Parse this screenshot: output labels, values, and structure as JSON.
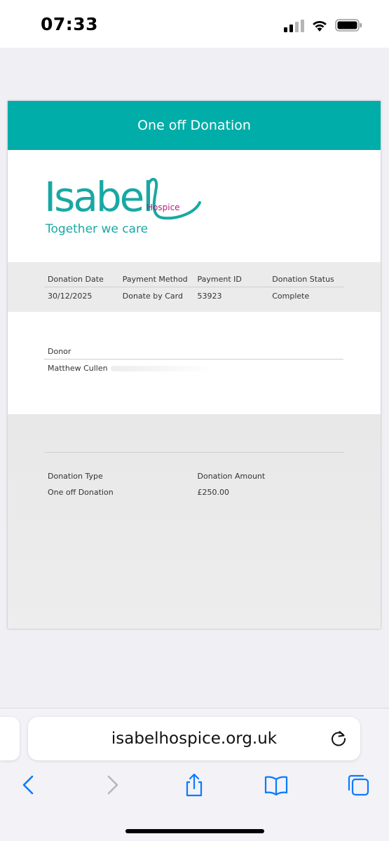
{
  "status_bar": {
    "time": "07:33"
  },
  "page": {
    "header_title": "One off Donation",
    "logo": {
      "name": "Isabel",
      "sub": "Hospice",
      "tagline": "Together we care"
    },
    "summary": {
      "headers": [
        "Donation Date",
        "Payment Method",
        "Payment ID",
        "Donation Status"
      ],
      "values": [
        "30/12/2025",
        "Donate by Card",
        "53923",
        "Complete"
      ]
    },
    "donor": {
      "header": "Donor",
      "value": "Matthew Cullen"
    },
    "details": {
      "headers": [
        "Donation Type",
        "Donation Amount"
      ],
      "values": [
        "One off Donation",
        "£250.00"
      ]
    }
  },
  "browser": {
    "url": "isabelhospice.org.uk",
    "icons": [
      "reload-icon",
      "back-icon",
      "forward-icon",
      "share-icon",
      "bookmarks-icon",
      "tabs-icon"
    ],
    "accent": "#0a7aff"
  },
  "colors": {
    "teal": "#00ada8",
    "magenta": "#b3207d"
  }
}
